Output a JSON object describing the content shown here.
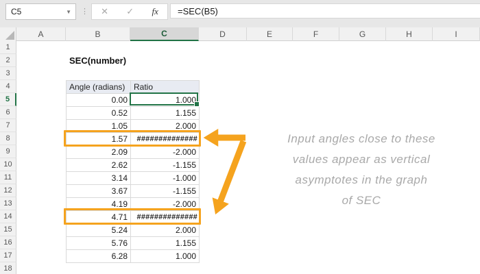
{
  "formula_bar": {
    "name_box_value": "C5",
    "formula_value": "=SEC(B5)",
    "cancel_label": "✕",
    "enter_label": "✓",
    "fx_label": "fx",
    "dropdown_glyph": "▼",
    "separator_glyph": "⋮"
  },
  "grid": {
    "column_headers": [
      "A",
      "B",
      "C",
      "D",
      "E",
      "F",
      "G",
      "H",
      "I"
    ],
    "selected_column": "C",
    "selected_row": 5,
    "row_count": 18,
    "selected_cell": "C5"
  },
  "sheet": {
    "title_cell": "SEC(number)",
    "table": {
      "headers": [
        "Angle (radians)",
        "Ratio"
      ],
      "rows": [
        [
          "0.00",
          "1.000"
        ],
        [
          "0.52",
          "1.155"
        ],
        [
          "1.05",
          "2.000"
        ],
        [
          "1.57",
          "##############"
        ],
        [
          "2.09",
          "-2.000"
        ],
        [
          "2.62",
          "-1.155"
        ],
        [
          "3.14",
          "-1.000"
        ],
        [
          "3.67",
          "-1.155"
        ],
        [
          "4.19",
          "-2.000"
        ],
        [
          "4.71",
          "##############"
        ],
        [
          "5.24",
          "2.000"
        ],
        [
          "5.76",
          "1.155"
        ],
        [
          "6.28",
          "1.000"
        ]
      ],
      "highlighted_sheet_rows": [
        8,
        14
      ]
    },
    "annotation": {
      "lines": [
        "Input angles close to these",
        "values appear as vertical",
        "asymptotes in the graph",
        "of SEC"
      ]
    }
  },
  "colors": {
    "accent_orange": "#f5a31e",
    "selection_green": "#217346",
    "table_header_fill": "#e8ebf2",
    "annotation_gray": "#a9a9a9"
  }
}
